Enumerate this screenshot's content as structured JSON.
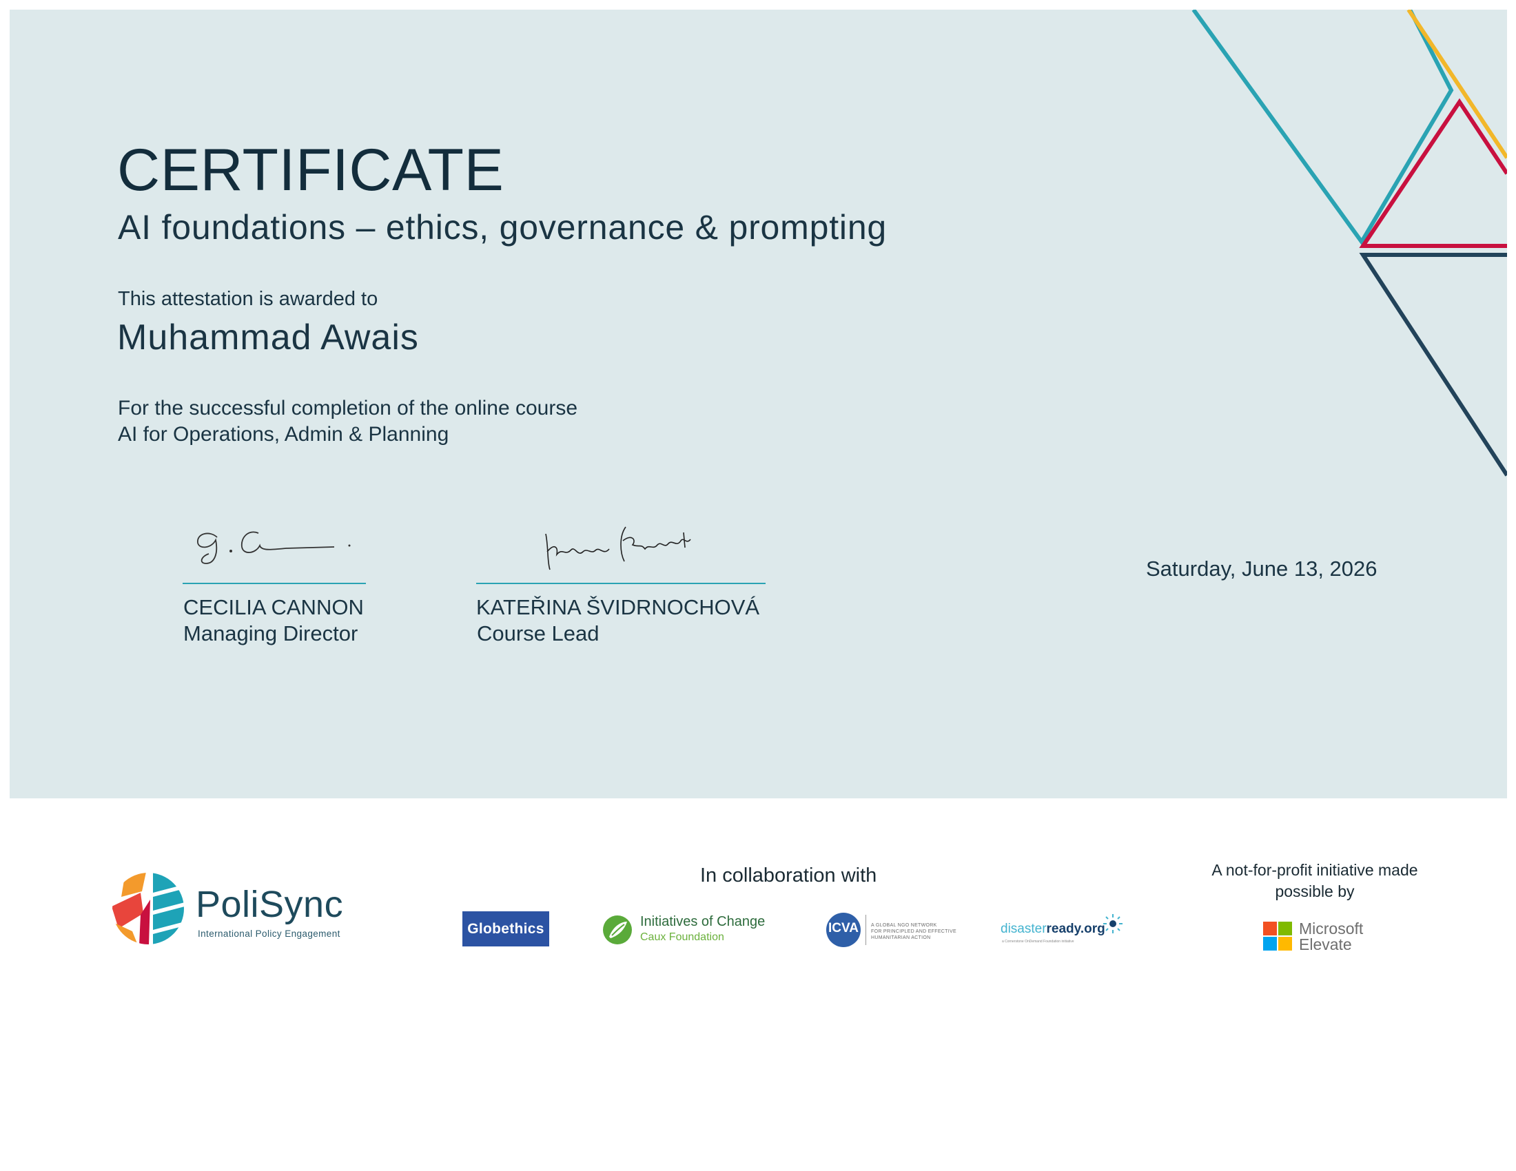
{
  "certificate": {
    "title": "CERTIFICATE",
    "subtitle": "AI foundations – ethics, governance & prompting",
    "awarded_text": "This attestation is awarded to",
    "recipient": "Muhammad Awais",
    "completion_line1": "For the successful completion of the online course",
    "completion_line2": "AI for Operations, Admin & Planning",
    "date": "Saturday, June 13, 2026"
  },
  "signatories": [
    {
      "name": "CECILIA CANNON",
      "role": "Managing Director"
    },
    {
      "name": "KATEŘINA ŠVIDRNOCHOVÁ",
      "role": "Course Lead"
    }
  ],
  "footer": {
    "brand": {
      "name": "PoliSync",
      "tagline": "International Policy Engagement"
    },
    "collaboration_label": "In collaboration with",
    "partners": {
      "globethics": "Globethics",
      "ioc_name": "Initiatives of Change",
      "ioc_sub": "Caux Foundation",
      "icva_abbr": "ICVA",
      "icva_line1": "A GLOBAL NGO NETWORK",
      "icva_line2": "FOR PRINCIPLED AND EFFECTIVE",
      "icva_line3": "HUMANITARIAN ACTION",
      "dr_part1": "disaster",
      "dr_part2": "ready.org",
      "dr_tagline": "a Cornerstone OnDemand Foundation initiative"
    },
    "initiative_text": "A not-for-profit initiative made possible by",
    "sponsor_line1": "Microsoft",
    "sponsor_line2": "Elevate"
  },
  "colors": {
    "panel_bg": "#dde9eb",
    "teal": "#2aa3b3",
    "crimson": "#c8103f",
    "gold": "#f2b72a",
    "navy": "#22435a"
  }
}
